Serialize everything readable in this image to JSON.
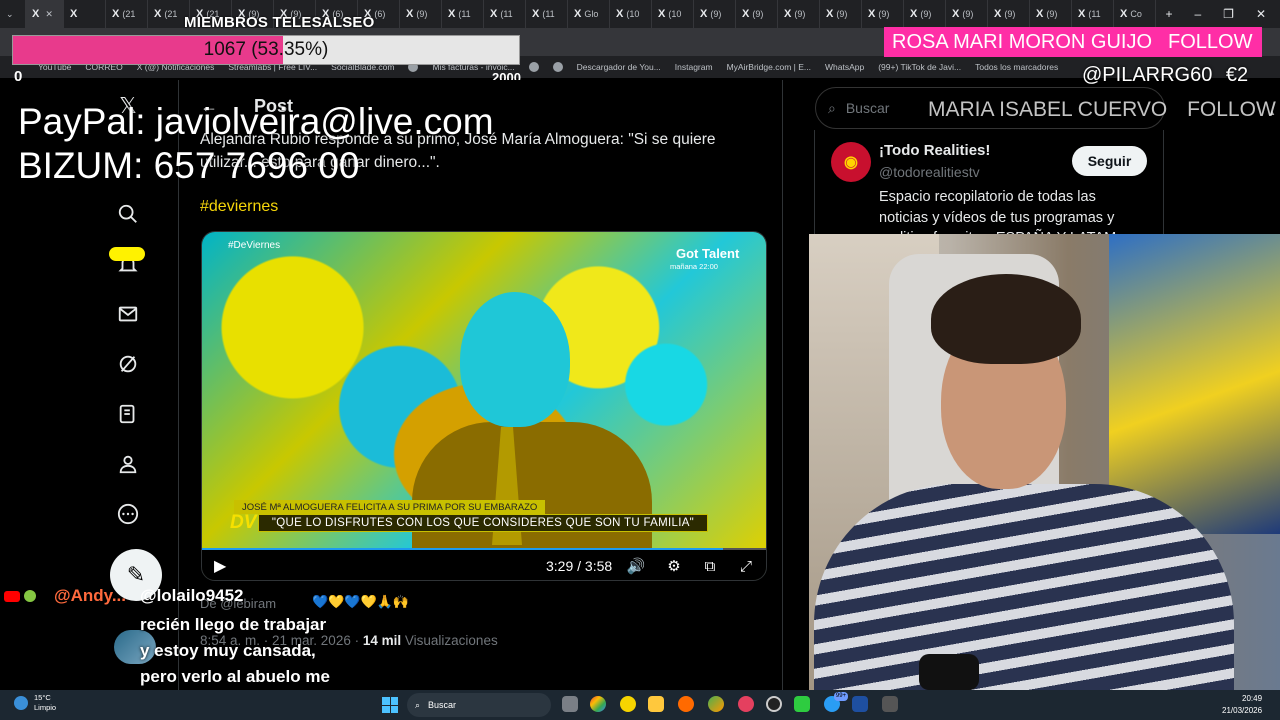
{
  "browser": {
    "tabs": [
      {
        "label": ""
      },
      {
        "label": ""
      },
      {
        "label": "(21"
      },
      {
        "label": "(21"
      },
      {
        "label": "(21"
      },
      {
        "label": "(9)"
      },
      {
        "label": "(9)"
      },
      {
        "label": "(6)"
      },
      {
        "label": "(6)"
      },
      {
        "label": "(9)"
      },
      {
        "label": "(11"
      },
      {
        "label": "(11"
      },
      {
        "label": "(11"
      },
      {
        "label": "Glo"
      },
      {
        "label": "(10"
      },
      {
        "label": "(10"
      },
      {
        "label": "(9)"
      },
      {
        "label": "(9)"
      },
      {
        "label": "(9)"
      },
      {
        "label": "(9)"
      },
      {
        "label": "(9)"
      },
      {
        "label": "(9)"
      },
      {
        "label": "(9)"
      },
      {
        "label": "(9)"
      },
      {
        "label": "(9)"
      },
      {
        "label": "(11"
      },
      {
        "label": "Co"
      }
    ],
    "bookmarks": [
      "YouTube",
      "CORREO",
      "X (@) Notificaciones",
      "Streamlabs | Free LIV...",
      "SocialBlade.com",
      "",
      "Mis facturas - invoic...",
      "",
      "",
      "Descargador de You...",
      "Instagram",
      "MyAirBridge.com | E...",
      "WhatsApp",
      "(99+) TikTok de Javi...",
      "Todos los marcadores"
    ]
  },
  "overlay": {
    "members_title": "MIEMBROS TELESALSEO",
    "goal_text": "1067 (53.35%)",
    "goal_fraction": 0.5335,
    "goal_min": "0",
    "goal_max": "2000",
    "follow_name": "ROSA MARI MORON GUIJO",
    "follow_label": "FOLLOW",
    "tip_user": "@PILARRG60",
    "tip_amount": "€2",
    "follow_name2": "MARIA ISABEL CUERVO",
    "follow_label2": "FOLLOW",
    "paypal_line": "PayPal: javiolveira@live.com",
    "bizum_line": "BIZUM: 657 7696 00",
    "colors": {
      "goal_fill": "#e83a8c",
      "follow_banner": "#ff2ea6"
    }
  },
  "post": {
    "header": "Post",
    "text": "Alejandra Rubio responde a su primo, José María Almoguera: \"Si se quiere utilizar... esto para ganar dinero...\".",
    "hashtag": "#deviernes",
    "video": {
      "tag": "#DeViernes",
      "brand": "Got Talent",
      "brand_sub": "mañana 22:00",
      "chyron_top": "JOSÉ Mª ALMOGUERA FELICITA A SU PRIMA POR SU EMBARAZO",
      "logo": "DV",
      "chyron_main": "\"QUE LO DISFRUTES CON LOS QUE CONSIDERES QUE SON TU FAMILIA\"",
      "time": "3:29 / 3:58",
      "progress_fraction": 0.92
    },
    "from": "De @lebiram",
    "meta_time": "8:54 a. m. · 21 mar. 2026 · ",
    "views_count": "14 mil",
    "views_label": "Visualizaciones"
  },
  "sidebar": {
    "search_placeholder": "Buscar",
    "account": {
      "name": "¡Todo Realities!",
      "handle": "@todorealitiestv",
      "follow": "Seguir",
      "bio": "Espacio recopilatorio de todas las noticias y vídeos de tus programas y realities favoritos. ESPAÑA Y LATAM"
    }
  },
  "chat": {
    "user1": "@Andy...",
    "user2": "@lolailo9452",
    "emoji_line": "💙💛💙💛🙏🙌",
    "message": "recién llego de trabajar y estoy muy cansada, pero verlo al abuelo me mejora el día..."
  },
  "taskbar": {
    "weather_temp": "15°C",
    "weather_desc": "Limpio",
    "search": "Buscar",
    "notif_count": "99+",
    "time": "20:49",
    "date": "21/03/2026"
  }
}
